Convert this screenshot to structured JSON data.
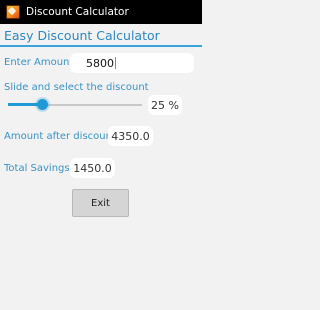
{
  "window": {
    "title": "Discount Calculator",
    "icon": "app-icon"
  },
  "heading": "Easy Discount Calculator",
  "amount": {
    "label": "Enter Amount",
    "value": "5800"
  },
  "discount": {
    "label": "Slide and select the discount",
    "value_text": "25 %",
    "percent": 25,
    "max": 100
  },
  "after_discount": {
    "label": "Amount after discount",
    "value": "4350.0"
  },
  "savings": {
    "label": "Total Savings",
    "value": "1450.0"
  },
  "exit_label": "Exit",
  "colors": {
    "accent": "#1f9ad6",
    "label_text": "#3a92c4",
    "heading": "#2c87bd",
    "background": "#f2f2f2"
  }
}
